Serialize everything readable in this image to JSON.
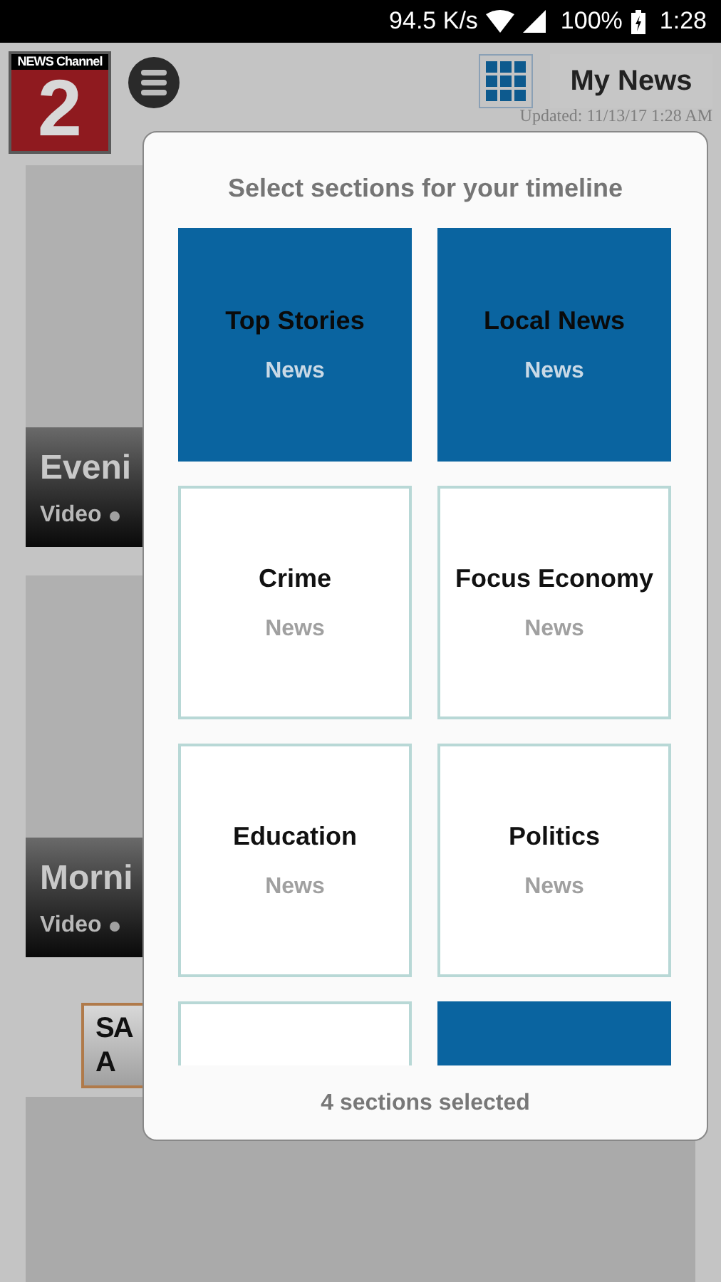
{
  "status_bar": {
    "speed": "94.5 K/s",
    "battery": "100%",
    "time": "1:28"
  },
  "header": {
    "logo": {
      "top": "NEWS Channel",
      "number": "2"
    },
    "my_news": "My News",
    "updated": "Updated: 11/13/17 1:28 AM"
  },
  "feed": [
    {
      "kind": "video",
      "title": "Eveni",
      "tag": "Video"
    },
    {
      "kind": "video",
      "title": "Morni",
      "tag": "Video"
    },
    {
      "kind": "ad",
      "lines": [
        "SA",
        "A"
      ]
    },
    {
      "kind": "blank"
    }
  ],
  "dialog": {
    "title": "Select sections for your timeline",
    "sections": [
      {
        "title": "Top Stories",
        "category": "News",
        "selected": true
      },
      {
        "title": "Local News",
        "category": "News",
        "selected": true
      },
      {
        "title": "Crime",
        "category": "News",
        "selected": false
      },
      {
        "title": "Focus Economy",
        "category": "News",
        "selected": false
      },
      {
        "title": "Education",
        "category": "News",
        "selected": false
      },
      {
        "title": "Politics",
        "category": "News",
        "selected": false
      },
      {
        "selected": false
      },
      {
        "selected": true
      }
    ],
    "footer": "4 sections selected"
  }
}
